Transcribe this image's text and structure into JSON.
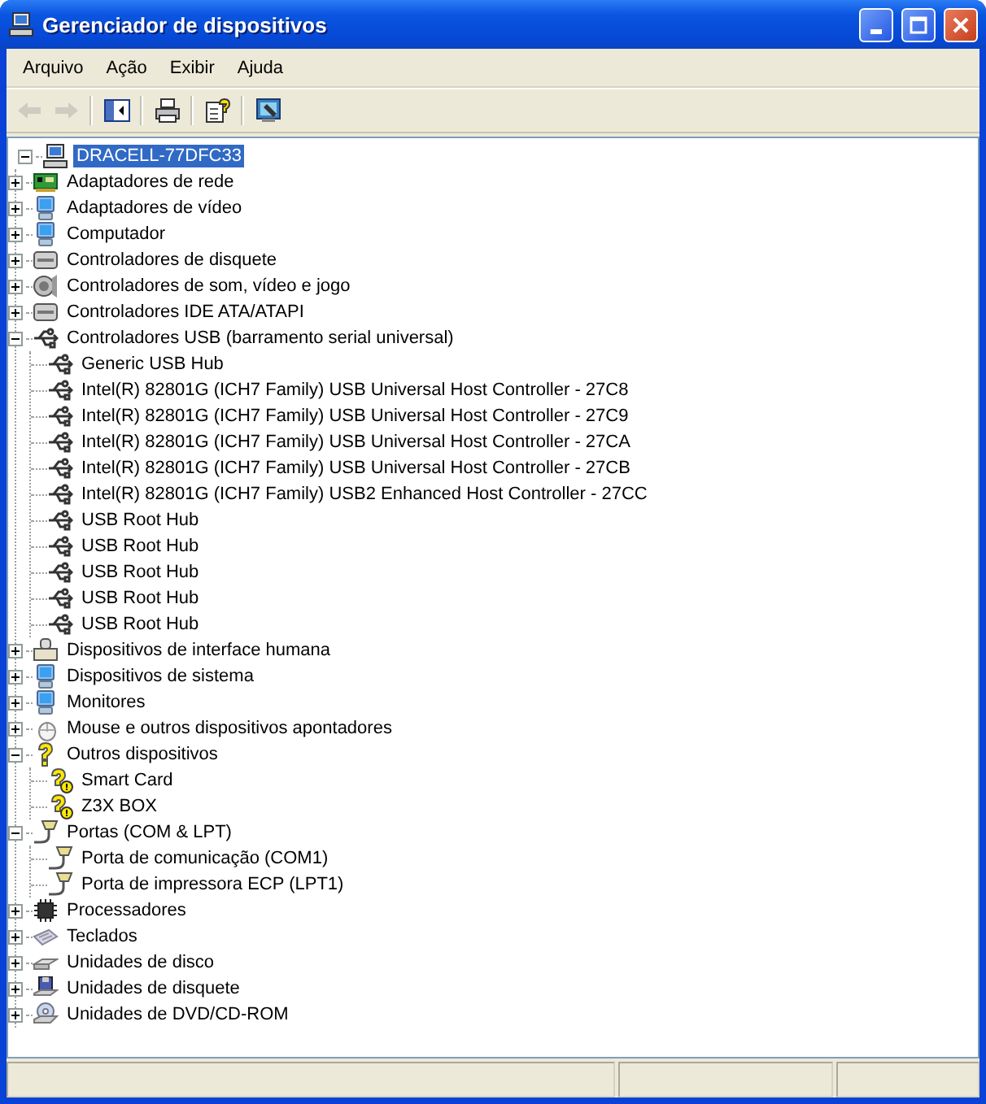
{
  "window": {
    "title": "Gerenciador de dispositivos"
  },
  "menu": [
    "Arquivo",
    "Ação",
    "Exibir",
    "Ajuda"
  ],
  "toolbar": [
    {
      "kind": "back",
      "disabled": true
    },
    {
      "kind": "forward",
      "disabled": true
    },
    {
      "kind": "sep"
    },
    {
      "kind": "tree",
      "disabled": false
    },
    {
      "kind": "sep"
    },
    {
      "kind": "print",
      "disabled": false
    },
    {
      "kind": "sep"
    },
    {
      "kind": "help",
      "disabled": false
    },
    {
      "kind": "sep"
    },
    {
      "kind": "scan",
      "disabled": false
    }
  ],
  "tree": {
    "label": "DRACELL-77DFC33",
    "kind": "computer",
    "expanded": true,
    "selected": true,
    "children": [
      {
        "label": "Adaptadores de rede",
        "kind": "network",
        "expanded": false,
        "selected": false
      },
      {
        "label": "Adaptadores de vídeo",
        "kind": "display",
        "expanded": false,
        "selected": false
      },
      {
        "label": "Computador",
        "kind": "display",
        "expanded": false,
        "selected": false
      },
      {
        "label": "Controladores de disquete",
        "kind": "controller",
        "expanded": false,
        "selected": false
      },
      {
        "label": "Controladores de som, vídeo e jogo",
        "kind": "sound",
        "expanded": false,
        "selected": false
      },
      {
        "label": "Controladores IDE ATA/ATAPI",
        "kind": "controller",
        "expanded": false,
        "selected": false
      },
      {
        "label": "Controladores USB (barramento serial universal)",
        "kind": "usb",
        "expanded": true,
        "selected": false,
        "children": [
          {
            "label": "Generic USB Hub",
            "kind": "usb",
            "selected": false
          },
          {
            "label": "Intel(R) 82801G (ICH7 Family) USB Universal Host Controller - 27C8",
            "kind": "usb",
            "selected": false
          },
          {
            "label": "Intel(R) 82801G (ICH7 Family) USB Universal Host Controller - 27C9",
            "kind": "usb",
            "selected": false
          },
          {
            "label": "Intel(R) 82801G (ICH7 Family) USB Universal Host Controller - 27CA",
            "kind": "usb",
            "selected": false
          },
          {
            "label": "Intel(R) 82801G (ICH7 Family) USB Universal Host Controller - 27CB",
            "kind": "usb",
            "selected": false
          },
          {
            "label": "Intel(R) 82801G (ICH7 Family) USB2 Enhanced Host Controller - 27CC",
            "kind": "usb",
            "selected": false
          },
          {
            "label": "USB Root Hub",
            "kind": "usb",
            "selected": false
          },
          {
            "label": "USB Root Hub",
            "kind": "usb",
            "selected": false
          },
          {
            "label": "USB Root Hub",
            "kind": "usb",
            "selected": false
          },
          {
            "label": "USB Root Hub",
            "kind": "usb",
            "selected": false
          },
          {
            "label": "USB Root Hub",
            "kind": "usb",
            "selected": false
          }
        ]
      },
      {
        "label": "Dispositivos de interface humana",
        "kind": "hid",
        "expanded": false,
        "selected": false
      },
      {
        "label": "Dispositivos de sistema",
        "kind": "display",
        "expanded": false,
        "selected": false
      },
      {
        "label": "Monitores",
        "kind": "display",
        "expanded": false,
        "selected": false
      },
      {
        "label": "Mouse e outros dispositivos apontadores",
        "kind": "mouse",
        "expanded": false,
        "selected": false
      },
      {
        "label": "Outros dispositivos",
        "kind": "unknown",
        "expanded": true,
        "selected": false,
        "children": [
          {
            "label": "Smart Card",
            "kind": "warning",
            "selected": false
          },
          {
            "label": "Z3X BOX",
            "kind": "warning",
            "selected": false
          }
        ]
      },
      {
        "label": "Portas (COM & LPT)",
        "kind": "port",
        "expanded": true,
        "selected": false,
        "children": [
          {
            "label": "Porta de comunicação (COM1)",
            "kind": "port",
            "selected": false
          },
          {
            "label": "Porta de impressora ECP (LPT1)",
            "kind": "port",
            "selected": false
          }
        ]
      },
      {
        "label": "Processadores",
        "kind": "cpu",
        "expanded": false,
        "selected": false
      },
      {
        "label": "Teclados",
        "kind": "keyboard",
        "expanded": false,
        "selected": false
      },
      {
        "label": "Unidades de disco",
        "kind": "drive",
        "expanded": false,
        "selected": false
      },
      {
        "label": "Unidades de disquete",
        "kind": "floppy",
        "expanded": false,
        "selected": false
      },
      {
        "label": "Unidades de DVD/CD-ROM",
        "kind": "dvd",
        "expanded": false,
        "selected": false
      }
    ]
  }
}
